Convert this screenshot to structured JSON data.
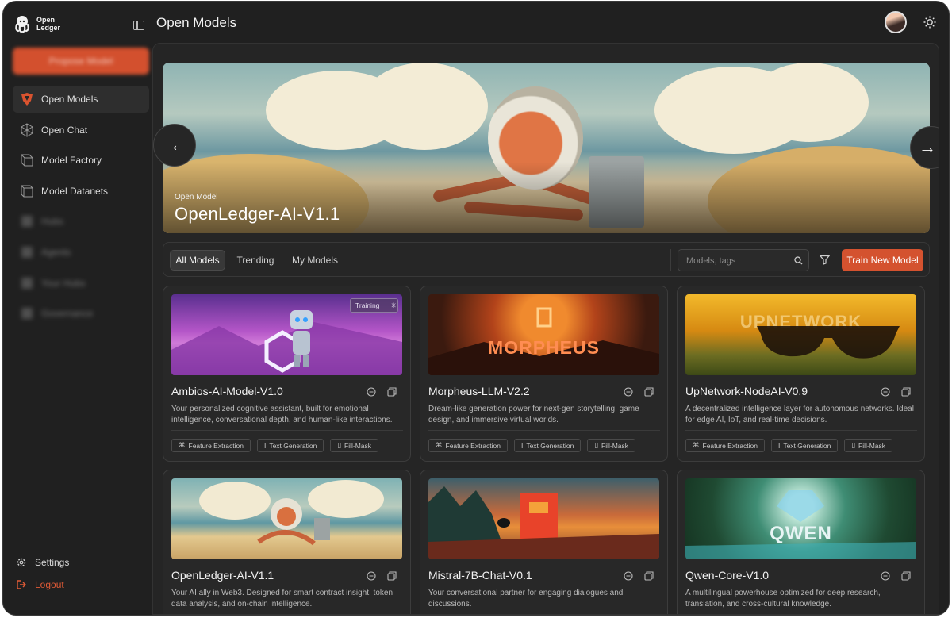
{
  "app": {
    "logo_line1": "Open",
    "logo_line2": "Ledger",
    "propose_label": "Propose Model",
    "page_title": "Open Models"
  },
  "sidebar": {
    "items": [
      {
        "label": "Open Models",
        "icon": "open-models-icon",
        "active": true
      },
      {
        "label": "Open Chat",
        "icon": "open-chat-icon"
      },
      {
        "label": "Model Factory",
        "icon": "model-factory-icon"
      },
      {
        "label": "Model Datanets",
        "icon": "model-datanets-icon"
      },
      {
        "label": "Hubs",
        "icon": "blurred-icon",
        "blurred": true
      },
      {
        "label": "Agents",
        "icon": "blurred-icon",
        "blurred": true
      },
      {
        "label": "Your Hubs",
        "icon": "blurred-icon",
        "blurred": true
      },
      {
        "label": "Governance",
        "icon": "blurred-icon",
        "blurred": true
      }
    ],
    "settings_label": "Settings",
    "logout_label": "Logout"
  },
  "hero": {
    "subtitle": "Open Model",
    "title": "OpenLedger-AI-V1.1"
  },
  "tabs": [
    "All Models",
    "Trending",
    "My Models"
  ],
  "search": {
    "placeholder": "Models, tags"
  },
  "train_button": "Train New Model",
  "colors": {
    "accent": "#d4522f",
    "background": "#202020",
    "card": "#282828"
  },
  "models": [
    {
      "name": "Ambios-AI-Model-V1.0",
      "description": "Your personalized cognitive assistant, built for emotional intelligence, conversational depth, and human-like interactions.",
      "badge": "Training",
      "image_text": "",
      "tags": [
        "Feature Extraction",
        "Text Generation",
        "Fill-Mask"
      ]
    },
    {
      "name": "Morpheus-LLM-V2.2",
      "description": "Dream-like generation power for next-gen storytelling, game design, and immersive virtual worlds.",
      "image_text": "MORPHEUS",
      "tags": [
        "Feature Extraction",
        "Text Generation",
        "Fill-Mask"
      ]
    },
    {
      "name": "UpNetwork-NodeAI-V0.9",
      "description": "A decentralized intelligence layer for autonomous networks. Ideal for edge AI, IoT, and real-time decisions.",
      "image_text": "UPNETWORK",
      "tags": [
        "Feature Extraction",
        "Text Generation",
        "Fill-Mask"
      ]
    },
    {
      "name": "OpenLedger-AI-V1.1",
      "description": "Your AI ally in Web3. Designed for smart contract insight, token data analysis, and on-chain intelligence.",
      "image_text": "",
      "tags": []
    },
    {
      "name": "Mistral-7B-Chat-V0.1",
      "description": "Your conversational partner for engaging dialogues and discussions.",
      "image_text": "",
      "tags": []
    },
    {
      "name": "Qwen-Core-V1.0",
      "description": "A multilingual powerhouse optimized for deep research, translation, and cross-cultural knowledge.",
      "image_text": "QWEN",
      "tags": []
    }
  ]
}
